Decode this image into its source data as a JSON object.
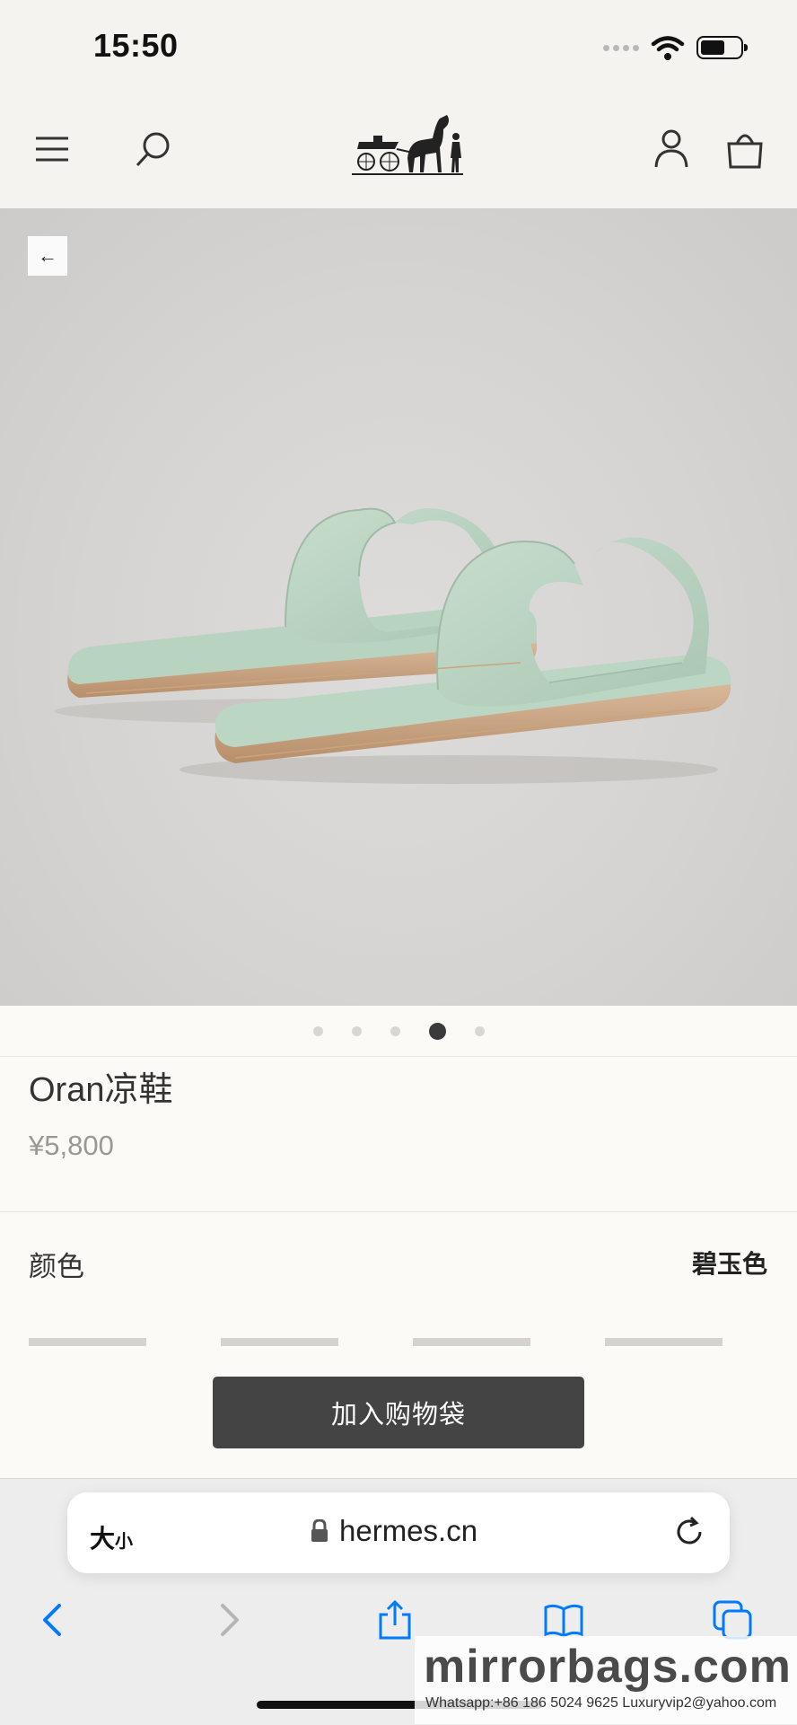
{
  "status_bar": {
    "time": "15:50"
  },
  "header": {
    "logo": "hermes-carriage-logo"
  },
  "hero": {
    "image": "mint-green-oran-sandals",
    "active_slide": 4,
    "slide_count": 5
  },
  "product": {
    "name": "Oran凉鞋",
    "price": "¥5,800"
  },
  "color": {
    "label": "颜色",
    "value": "碧玉色"
  },
  "cart": {
    "button_label": "加入购物袋"
  },
  "safari": {
    "aa_main": "大",
    "aa_small": "小",
    "url": "hermes.cn"
  },
  "watermark": {
    "main": "mirrorbags.com",
    "contacts": "Whatsapp:+86 186 5024 9625  Luxuryvip2@yahoo.com"
  },
  "colors": {
    "accent": "#007aff",
    "button": "#444444",
    "background": "#f5f3ef",
    "sandal": "#b9d3c1"
  }
}
